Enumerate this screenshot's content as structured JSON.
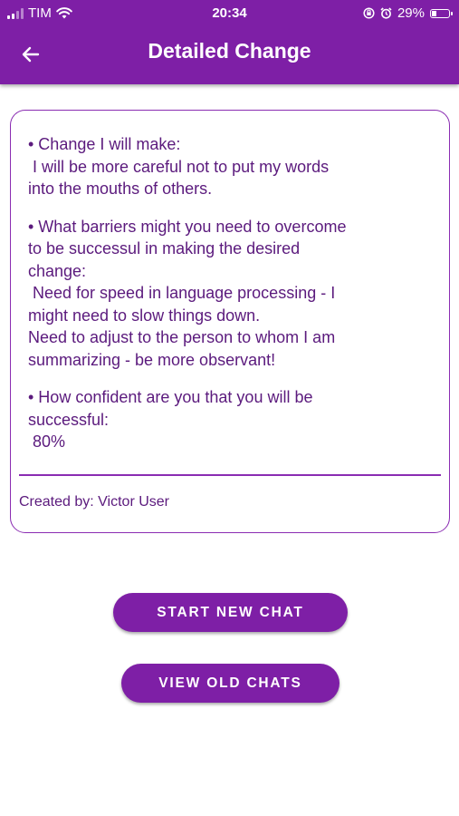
{
  "status_bar": {
    "carrier": "TIM",
    "time": "20:34",
    "battery": "29%",
    "battery_level": 0.29,
    "icons": [
      "signal-icon",
      "wifi-icon",
      "screen-lock-icon",
      "alarm-icon",
      "battery-icon"
    ]
  },
  "appbar": {
    "title": "Detailed Change",
    "back_icon": "arrow-left-icon"
  },
  "card": {
    "sections": [
      {
        "lines": [
          "• Change I will make:",
          " I will be more careful not to put my words",
          "into the mouths of others."
        ]
      },
      {
        "lines": [
          "• What barriers might you need to overcome",
          "to be successul in making the desired",
          "change:",
          " Need for speed in language processing - I",
          "might need to slow things down.",
          "Need to adjust to the person to whom I am",
          "summarizing - be more observant!"
        ]
      },
      {
        "lines": [
          "• How confident are you that you will be",
          "successful:",
          " 80%"
        ]
      }
    ],
    "created_by": "Created by: Victor User"
  },
  "buttons": {
    "start_new_chat": "START NEW CHAT",
    "view_old_chats": "VIEW OLD CHATS"
  },
  "colors": {
    "primary": "#7e1fa6",
    "text": "#5b1a7d",
    "border": "#8a2cb2"
  }
}
